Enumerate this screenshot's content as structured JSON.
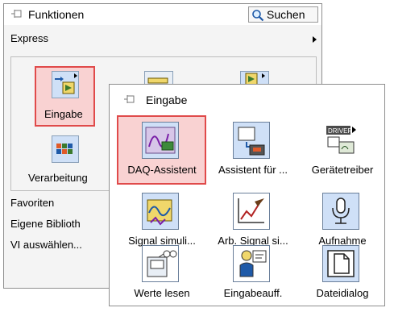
{
  "palette": {
    "title": "Funktionen",
    "search_label": "Suchen",
    "categories": [
      {
        "label": "Express"
      },
      {
        "label": "Favoriten"
      },
      {
        "label": "Eigene Biblioth"
      },
      {
        "label": "VI auswählen..."
      }
    ],
    "express_items": [
      {
        "label": "Eingabe",
        "selected": true
      },
      {
        "label": "Verarbeitung"
      }
    ]
  },
  "subpalette": {
    "title": "Eingabe",
    "items": [
      {
        "label": "DAQ-Assistent",
        "selected": true
      },
      {
        "label": "Assistent für ..."
      },
      {
        "label": "Gerätetreiber",
        "badge": "DRIVERS"
      },
      {
        "label": "Signal simuli..."
      },
      {
        "label": "Arb. Signal si..."
      },
      {
        "label": "Aufnahme"
      },
      {
        "label": "Werte lesen"
      },
      {
        "label": "Eingabeauff."
      },
      {
        "label": "Dateidialog"
      }
    ]
  },
  "colors": {
    "selection_border": "#e04a4a",
    "selection_fill": "#f9d2d2",
    "icon_fill": "#cfe0f7"
  },
  "icons": [
    "pin-icon",
    "magnifier-icon",
    "submenu-arrow-icon"
  ]
}
